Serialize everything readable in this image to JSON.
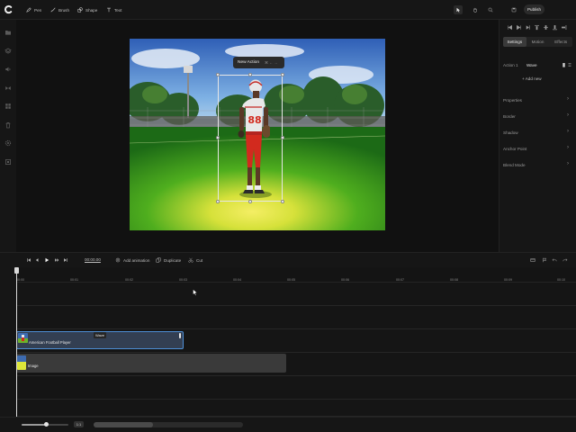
{
  "toolbar": {
    "tools": [
      {
        "label": "Pen",
        "icon": "pen-icon"
      },
      {
        "label": "Brush",
        "icon": "brush-icon"
      },
      {
        "label": "Shape",
        "icon": "shape-icon"
      },
      {
        "label": "Text",
        "icon": "text-icon"
      }
    ],
    "publish_label": "Publish"
  },
  "canvas": {
    "popup_label": "New Action",
    "popup_shortcut": "⌘  ←  →",
    "jersey_number": "88"
  },
  "right_panel": {
    "tabs": [
      {
        "label": "Settings",
        "active": true
      },
      {
        "label": "Motion",
        "active": false
      },
      {
        "label": "Effects",
        "active": false
      }
    ],
    "action_label": "Action 1",
    "action_value": "Wave",
    "add_new": "+ Add new",
    "sections": [
      "Properties",
      "Border",
      "Shadow",
      "Anchor Point",
      "Blend Mode"
    ]
  },
  "playback": {
    "timecode": "00:00.00",
    "add_animation": "Add animation",
    "duplicate": "Duplicate",
    "cut": "Cut"
  },
  "timeline": {
    "ticks": [
      "00:00",
      "00:01",
      "00:02",
      "00:03",
      "00:04",
      "00:05",
      "00:06",
      "00:07",
      "00:08",
      "00:09",
      "00:10"
    ],
    "clips": [
      {
        "label": "American Football Player",
        "tag": "Wave"
      },
      {
        "label": "Image"
      }
    ]
  },
  "footer": {
    "fit_label": "1:1",
    "zoom_fraction": 0.52
  },
  "colors": {
    "accent": "#4e8fd6",
    "background": "#161616",
    "jersey": "#e8e8e8",
    "pants": "#d22a1e"
  }
}
